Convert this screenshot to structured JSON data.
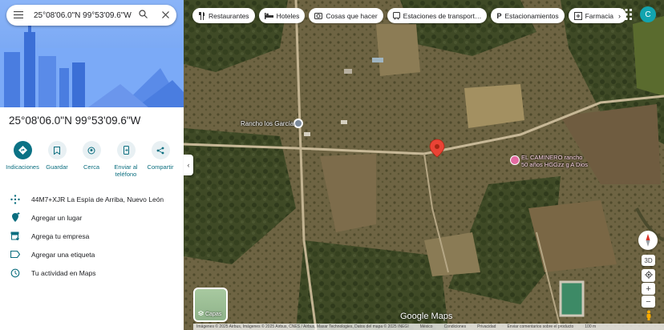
{
  "search": {
    "query": "25°08'06.0\"N 99°53'09.6\"W"
  },
  "place": {
    "title": "25°08'06.0\"N 99°53'09.6\"W"
  },
  "actions": [
    {
      "label": "Indicaciones",
      "icon": "directions-icon"
    },
    {
      "label": "Guardar",
      "icon": "bookmark-icon"
    },
    {
      "label": "Cerca",
      "icon": "nearby-icon"
    },
    {
      "label": "Enviar al teléfono",
      "icon": "phone-icon"
    },
    {
      "label": "Compartir",
      "icon": "share-icon"
    }
  ],
  "info": [
    {
      "text": "44M7+XJR La Espía de Arriba, Nuevo León",
      "icon": "plus-code-icon"
    },
    {
      "text": "Agregar un lugar",
      "icon": "add-place-icon"
    },
    {
      "text": "Agrega tu empresa",
      "icon": "business-icon"
    },
    {
      "text": "Agregar una etiqueta",
      "icon": "label-icon"
    },
    {
      "text": "Tu actividad en Maps",
      "icon": "history-icon"
    }
  ],
  "chips": [
    {
      "label": "Restaurantes",
      "icon": "restaurant-icon"
    },
    {
      "label": "Hoteles",
      "icon": "hotel-icon"
    },
    {
      "label": "Cosas que hacer",
      "icon": "camera-icon"
    },
    {
      "label": "Estaciones de transport…",
      "icon": "transit-icon"
    },
    {
      "label": "Estacionamientos",
      "icon": "parking-icon"
    },
    {
      "label": "Farmacia",
      "icon": "pharmacy-icon"
    }
  ],
  "user": {
    "initial": "C"
  },
  "map": {
    "label_rancho": "Rancho los García",
    "poi_line1": "EL CAMINERO rancho",
    "poi_line2": "50 años HGGzz g A Dios",
    "layers_label": "Capas",
    "logo": "Google Maps",
    "tilt": "3D",
    "zoom_in": "+",
    "zoom_out": "−",
    "footer": [
      "Imágenes © 2025 Airbus, Imágenes © 2025 Airbus, CNES / Airbus, Maxar Technologies, Datos del mapa © 2025 INEGI",
      "México",
      "Condiciones",
      "Privacidad",
      "Enviar comentarios sobre el producto",
      "100 m"
    ]
  },
  "colors": {
    "accent": "#0b7285",
    "pin": "#ea4335",
    "avatar": "#12a4af"
  }
}
